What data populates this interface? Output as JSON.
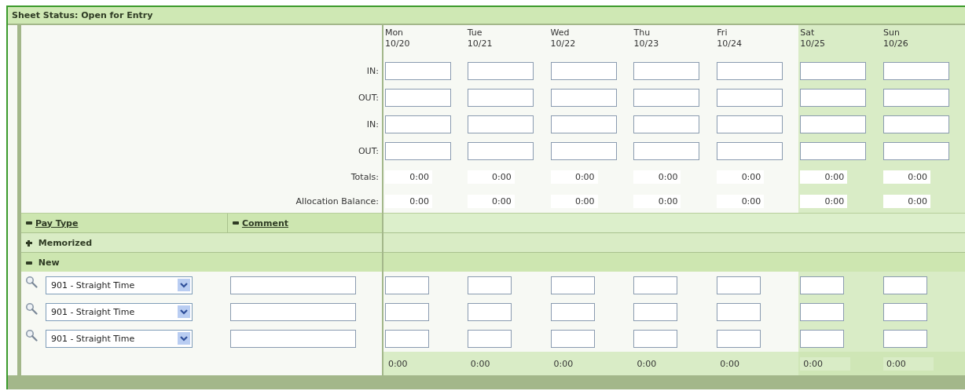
{
  "header": {
    "title": "Sheet Status: Open for Entry"
  },
  "days": [
    {
      "name": "Mon",
      "date": "10/20",
      "weekend": false
    },
    {
      "name": "Tue",
      "date": "10/21",
      "weekend": false
    },
    {
      "name": "Wed",
      "date": "10/22",
      "weekend": false
    },
    {
      "name": "Thu",
      "date": "10/23",
      "weekend": false
    },
    {
      "name": "Fri",
      "date": "10/24",
      "weekend": false
    },
    {
      "name": "Sat",
      "date": "10/25",
      "weekend": true
    },
    {
      "name": "Sun",
      "date": "10/26",
      "weekend": true
    }
  ],
  "punch_rows": [
    {
      "label": "IN:"
    },
    {
      "label": "OUT:"
    },
    {
      "label": "IN:"
    },
    {
      "label": "OUT:"
    }
  ],
  "summary_rows": [
    {
      "label": "Totals:",
      "values": [
        "0:00",
        "0:00",
        "0:00",
        "0:00",
        "0:00",
        "0:00",
        "0:00"
      ]
    },
    {
      "label": "Allocation Balance:",
      "values": [
        "0:00",
        "0:00",
        "0:00",
        "0:00",
        "0:00",
        "0:00",
        "0:00"
      ]
    }
  ],
  "columns": [
    {
      "label": "Pay Type",
      "expanded": true
    },
    {
      "label": "Comment",
      "expanded": true
    }
  ],
  "groups": [
    {
      "label": "Memorized",
      "expanded": false
    },
    {
      "label": "New",
      "expanded": true,
      "entries": [
        {
          "pay_type": "901 - Straight Time"
        },
        {
          "pay_type": "901 - Straight Time"
        },
        {
          "pay_type": "901 - Straight Time"
        }
      ]
    }
  ],
  "footer_totals": [
    "0:00",
    "0:00",
    "0:00",
    "0:00",
    "0:00",
    "0:00",
    "0:00"
  ]
}
